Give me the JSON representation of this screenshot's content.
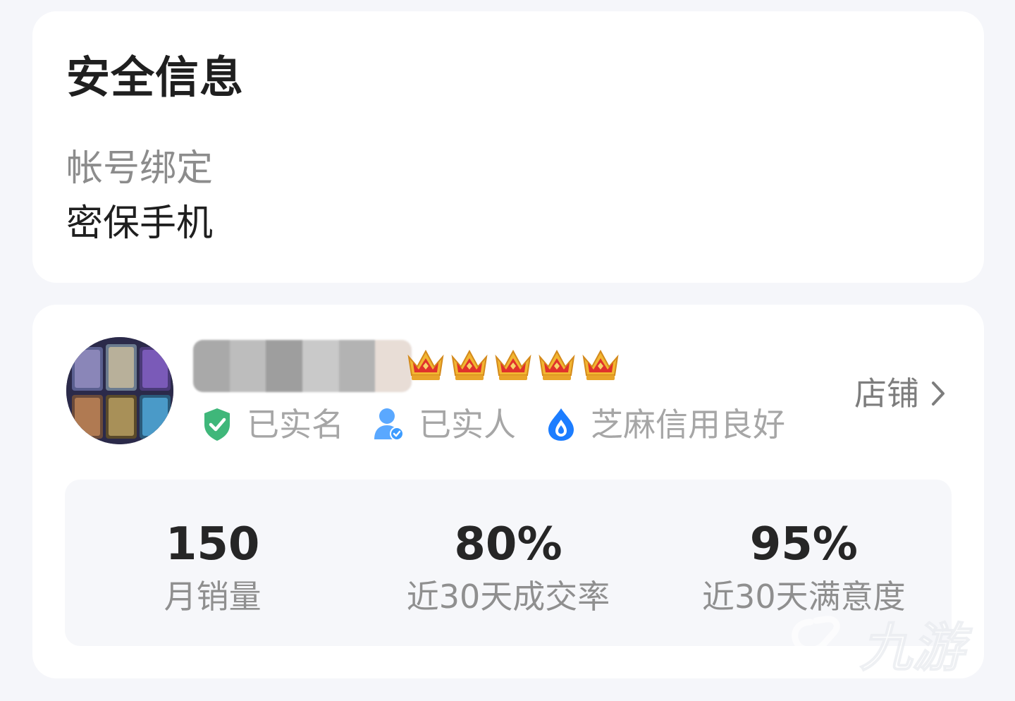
{
  "security": {
    "title": "安全信息",
    "binding_label": "帐号绑定",
    "binding_value": "密保手机"
  },
  "seller": {
    "avatar": "game-heroes-avatar",
    "name_masked": true,
    "crown_count": 5,
    "shop_label": "店铺",
    "badges": [
      {
        "icon": "shield-check-icon",
        "label": "已实名",
        "color": "#3fb77a"
      },
      {
        "icon": "person-verified-icon",
        "label": "已实人",
        "color": "#3d9cff"
      },
      {
        "icon": "drop-icon",
        "label": "芝麻信用良好",
        "color": "#1c7dff"
      }
    ],
    "stats": [
      {
        "value": "150",
        "label": "月销量"
      },
      {
        "value": "80%",
        "label": "近30天成交率"
      },
      {
        "value": "95%",
        "label": "近30天满意度"
      }
    ]
  },
  "watermark": {
    "text": "九游"
  },
  "colors": {
    "background": "#f5f6fa",
    "card": "#ffffff",
    "crown_red": "#e0322b",
    "crown_gold": "#f2b632"
  }
}
